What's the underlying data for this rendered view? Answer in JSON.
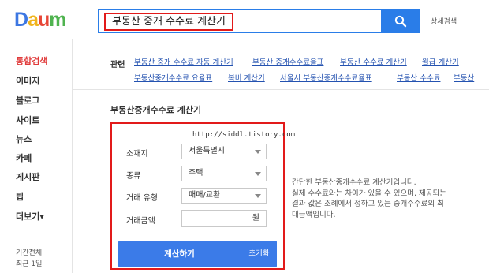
{
  "header": {
    "logo_letters": [
      "D",
      "a",
      "u",
      "m"
    ],
    "logo_colors": [
      "#3d77e2",
      "#f0b41c",
      "#e74637",
      "#4fb34f"
    ],
    "search_query": "부동산 중개 수수료 계산기",
    "search_icon": "search-icon",
    "detail_search_label": "상세검색",
    "accent_color": "#2a7de8"
  },
  "sidebar": {
    "items": [
      {
        "label": "통합검색",
        "active": true
      },
      {
        "label": "이미지"
      },
      {
        "label": "블로그"
      },
      {
        "label": "사이트"
      },
      {
        "label": "뉴스"
      },
      {
        "label": "카페"
      },
      {
        "label": "게시판"
      },
      {
        "label": "팁"
      },
      {
        "label": "더보기▾"
      }
    ],
    "period_label": "기간전체",
    "period_option": "최근 1일",
    "active_color": "#e03a3a"
  },
  "related": {
    "label": "관련",
    "links": [
      "부동산 중개 수수료 자동 계산기",
      "부동산 중개수수료율표",
      "부동산 수수료 계산기",
      "월급 계산기",
      "부동산중개수수료 요율표",
      "복비 계산기",
      "서울시 부동산중개수수료율표",
      "부동산 수수료",
      "부동산"
    ]
  },
  "calculator": {
    "title": "부동산중개수수료 계산기",
    "watermark": "http://siddl.tistory.com",
    "location_label": "소재지",
    "location_value": "서울특별시",
    "type_label": "종류",
    "type_value": "주택",
    "deal_label": "거래 유형",
    "deal_value": "매매/교환",
    "amount_label": "거래금액",
    "amount_value": "",
    "amount_unit": "원",
    "calc_button": "계산하기",
    "reset_button": "초기화",
    "button_color": "#3b7be8",
    "highlight_color": "#e21a1a"
  },
  "description": {
    "line1": "간단한 부동산중개수수료 계산기입니다.",
    "line2": "실제 수수료와는 차이가 있을 수 있으며, 제공되는",
    "line3": "결과 값은 조례에서 정하고 있는 중개수수료의 최",
    "line4": "대금액입니다."
  }
}
